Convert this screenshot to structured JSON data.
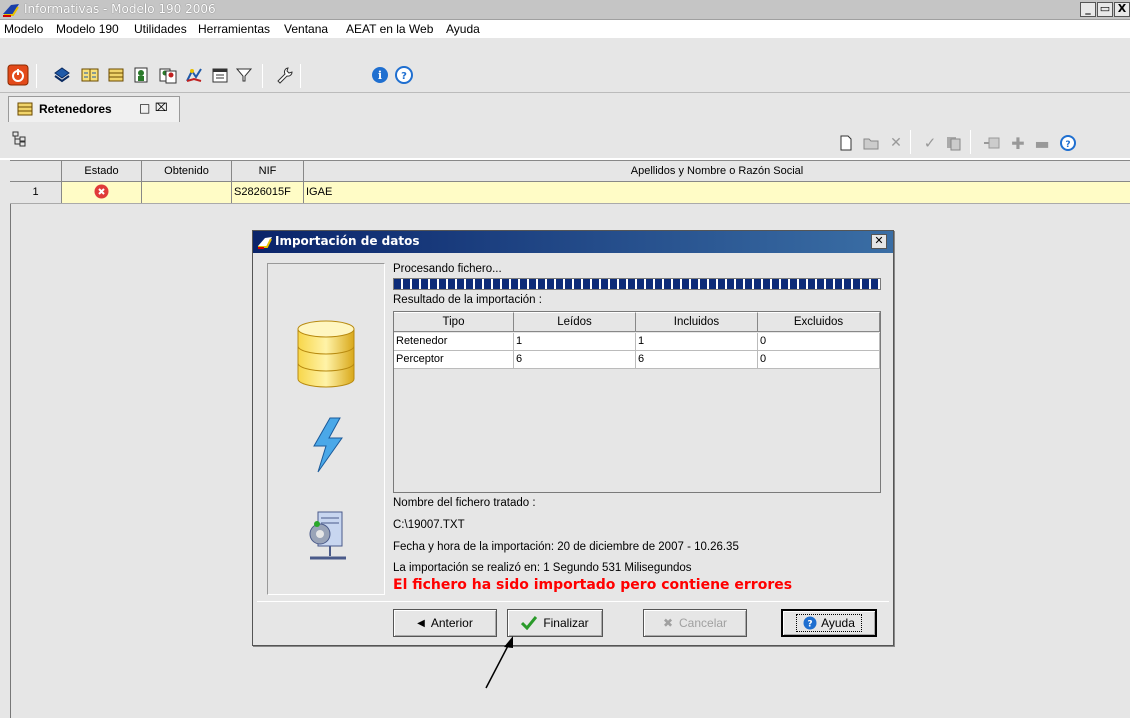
{
  "window": {
    "title": "Informativas - Modelo 190 2006",
    "min_label": "_",
    "restore_label": "&#9633;",
    "close_label": "X"
  },
  "menu": [
    "Modelo",
    "Modelo 190",
    "Utilidades",
    "Herramientas",
    "Ventana",
    "AEAT en la Web",
    "Ayuda"
  ],
  "tab": {
    "label": "Retenedores"
  },
  "grid": {
    "columns": [
      "",
      "Estado",
      "Obtenido",
      "NIF",
      "Apellidos y Nombre o Razón Social"
    ],
    "rows": [
      {
        "num": "1",
        "estado": "error",
        "obtenido": "",
        "nif": "S2826015F",
        "nombre": "IGAE"
      }
    ]
  },
  "dialog": {
    "title": "Importación de datos",
    "processing_label": "Procesando fichero...",
    "progress": 1.0,
    "result_label": "Resultado de la importación :",
    "table_columns": [
      "Tipo",
      "Leídos",
      "Incluidos",
      "Excluidos"
    ],
    "table_rows": [
      [
        "Retenedor",
        "1",
        "1",
        "0"
      ],
      [
        "Perceptor",
        "6",
        "6",
        "0"
      ]
    ],
    "file_label": "Nombre del fichero tratado :",
    "file_path": "C:\\19007.TXT",
    "datetime_text": "Fecha y hora de la importación: 20 de diciembre de 2007 - 10.26.35",
    "duration_text": "La importación se realizó en: 1 Segundo 531 Milisegundos",
    "error_message": "El fichero ha sido importado pero contiene errores",
    "buttons": {
      "anterior": "Anterior",
      "finalizar": "Finalizar",
      "cancelar": "Cancelar",
      "ayuda": "Ayuda"
    }
  },
  "colors": {
    "row_highlight": "#fffcc6",
    "error_text": "#ff0000",
    "dialog_title": "#0a246a",
    "progress": "#0c2b78"
  }
}
